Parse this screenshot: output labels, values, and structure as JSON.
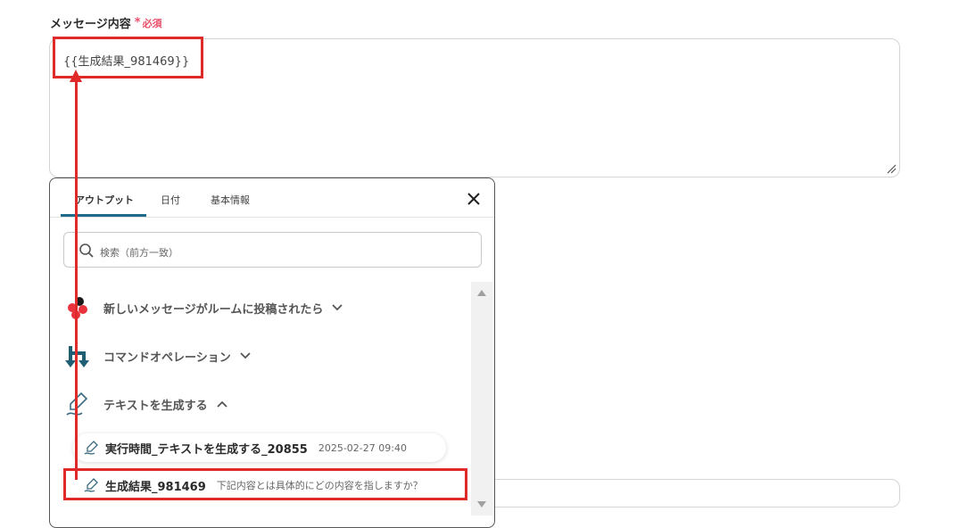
{
  "field": {
    "label": "メッセージ内容",
    "required_star": "*",
    "required_text": "必須"
  },
  "textarea": {
    "value": "{{生成結果_981469}}"
  },
  "popup": {
    "tabs": [
      {
        "label": "アウトプット"
      },
      {
        "label": "日付"
      },
      {
        "label": "基本情報"
      }
    ],
    "search": {
      "placeholder": "検索（前方一致）"
    },
    "groups": [
      {
        "label": "新しいメッセージがルームに投稿されたら",
        "icon": "chatwork-icon"
      },
      {
        "label": "コマンドオペレーション",
        "icon": "branch-icon"
      },
      {
        "label": "テキストを生成する",
        "icon": "pen-icon"
      }
    ],
    "items": [
      {
        "label": "実行時間_テキストを生成する_20855",
        "sub": "2025-02-27 09:40"
      },
      {
        "label": "生成結果_981469",
        "sub": "下記内容とは具体的にどの内容を指しますか？"
      }
    ]
  },
  "colors": {
    "accent": "#1f6b8a",
    "required": "#e8506a",
    "highlight": "#e02a2a"
  }
}
